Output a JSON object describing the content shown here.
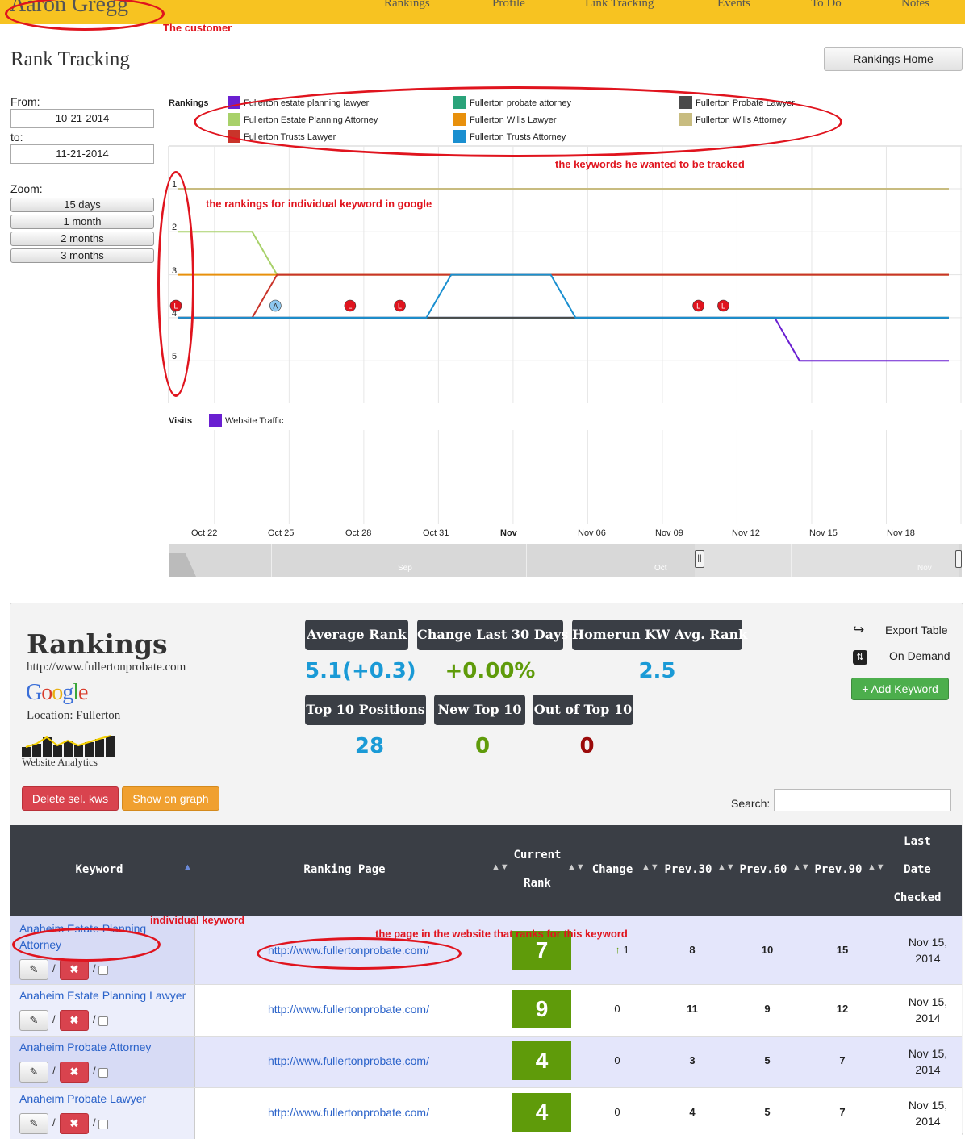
{
  "header": {
    "brand": "Aaron Gregg",
    "nav": [
      "Rankings",
      "Profile",
      "Link Tracking",
      "Events",
      "To Do",
      "Notes"
    ]
  },
  "annotations": {
    "customer": "The customer",
    "keywords": "the keywords he wanted to be tracked",
    "rankings": "the rankings for individual keyword in google",
    "individual": "individual keyword",
    "page": "the page in the website that ranks for this keyword"
  },
  "page": {
    "title": "Rank Tracking",
    "home_button": "Rankings Home"
  },
  "controls": {
    "from_label": "From:",
    "from_value": "10-21-2014",
    "to_label": "to:",
    "to_value": "11-21-2014",
    "zoom_label": "Zoom:",
    "zoom_options": [
      "15 days",
      "1 month",
      "2 months",
      "3 months"
    ]
  },
  "chart_data": {
    "type": "line",
    "title": "",
    "legend_title": "Rankings",
    "legend_placement": "top",
    "grid": true,
    "y_inverted": true,
    "ylim": [
      1,
      5
    ],
    "y_ticks": [
      "1",
      "2",
      "3",
      "4",
      "5"
    ],
    "x_ticks": [
      "Oct 22",
      "Oct 25",
      "Oct 28",
      "Oct 31",
      "Nov",
      "Nov 06",
      "Nov 09",
      "Nov 12",
      "Nov 15",
      "Nov 18"
    ],
    "x_dates": [
      "10-21",
      "10-22",
      "10-23",
      "10-24",
      "10-25",
      "10-26",
      "10-27",
      "10-28",
      "10-29",
      "10-30",
      "10-31",
      "11-01",
      "11-02",
      "11-03",
      "11-04",
      "11-05",
      "11-06",
      "11-07",
      "11-08",
      "11-09",
      "11-10",
      "11-11",
      "11-12",
      "11-13",
      "11-14",
      "11-15",
      "11-16",
      "11-17",
      "11-18",
      "11-19",
      "11-20",
      "11-21"
    ],
    "series": [
      {
        "name": "Fullerton estate planning lawyer",
        "color": "#6a1fd1",
        "values": [
          4,
          4,
          4,
          4,
          4,
          4,
          4,
          4,
          4,
          4,
          4,
          4,
          4,
          4,
          4,
          4,
          4,
          4,
          4,
          4,
          4,
          4,
          4,
          4,
          4,
          5,
          5,
          5,
          5,
          5,
          5,
          5
        ]
      },
      {
        "name": "Fullerton probate attorney",
        "color": "#2aa37a",
        "values": [
          4,
          4,
          4,
          4,
          4,
          4,
          4,
          4,
          4,
          4,
          4,
          4,
          4,
          4,
          4,
          4,
          4,
          4,
          4,
          4,
          4,
          4,
          4,
          4,
          4,
          4,
          4,
          4,
          4,
          4,
          4,
          4
        ]
      },
      {
        "name": "Fullerton Probate Lawyer",
        "color": "#4a4a4a",
        "values": [
          4,
          4,
          4,
          4,
          4,
          4,
          4,
          4,
          4,
          4,
          4,
          4,
          4,
          4,
          4,
          4,
          4,
          4,
          4,
          4,
          4,
          4,
          4,
          4,
          4,
          4,
          4,
          4,
          4,
          4,
          4,
          4
        ]
      },
      {
        "name": "Fullerton Estate Planning Attorney",
        "color": "#a8d16a",
        "values": [
          2,
          2,
          2,
          2,
          3,
          3,
          3,
          3,
          3,
          3,
          3,
          3,
          3,
          3,
          3,
          3,
          3,
          3,
          3,
          3,
          3,
          3,
          3,
          3,
          3,
          3,
          3,
          3,
          3,
          3,
          3,
          3
        ]
      },
      {
        "name": "Fullerton Wills Lawyer",
        "color": "#e8900c",
        "values": [
          3,
          3,
          3,
          3,
          3,
          3,
          3,
          3,
          3,
          3,
          3,
          3,
          3,
          3,
          3,
          3,
          3,
          3,
          3,
          3,
          3,
          3,
          3,
          3,
          3,
          3,
          3,
          3,
          3,
          3,
          3,
          3
        ]
      },
      {
        "name": "Fullerton Wills Attorney",
        "color": "#c8bc80",
        "values": [
          1,
          1,
          1,
          1,
          1,
          1,
          1,
          1,
          1,
          1,
          1,
          1,
          1,
          1,
          1,
          1,
          1,
          1,
          1,
          1,
          1,
          1,
          1,
          1,
          1,
          1,
          1,
          1,
          1,
          1,
          1,
          1
        ]
      },
      {
        "name": "Fullerton Trusts Lawyer",
        "color": "#c9342a",
        "values": [
          4,
          4,
          4,
          4,
          3,
          3,
          3,
          3,
          3,
          3,
          3,
          3,
          3,
          3,
          3,
          3,
          3,
          3,
          3,
          3,
          3,
          3,
          3,
          3,
          3,
          3,
          3,
          3,
          3,
          3,
          3,
          3
        ]
      },
      {
        "name": "Fullerton Trusts Attorney",
        "color": "#1a8fd0",
        "values": [
          4,
          4,
          4,
          4,
          4,
          4,
          4,
          4,
          4,
          4,
          4,
          3,
          3,
          3,
          3,
          3,
          4,
          4,
          4,
          4,
          4,
          4,
          4,
          4,
          4,
          4,
          4,
          4,
          4,
          4,
          4,
          4
        ]
      }
    ],
    "flags": [
      {
        "label": "L",
        "date": "10-21",
        "color": "#e0141e"
      },
      {
        "label": "A",
        "date": "10-25",
        "color": "#8ec8f0"
      },
      {
        "label": "L",
        "date": "10-28",
        "color": "#e0141e"
      },
      {
        "label": "L",
        "date": "10-30",
        "color": "#e0141e"
      },
      {
        "label": "L",
        "date": "11-11",
        "color": "#e0141e"
      },
      {
        "label": "L",
        "date": "11-12",
        "color": "#e0141e"
      }
    ],
    "visits": {
      "legend_title": "Visits",
      "series_name": "Website Traffic",
      "color": "#6a1fd1"
    },
    "navigator_labels": [
      "Sep",
      "Oct",
      "Nov"
    ]
  },
  "rankings_panel": {
    "title": "Rankings",
    "url": "http://www.fullertonprobate.com",
    "engine": "Google",
    "location": "Location: Fullerton",
    "analytics_label": "Website Analytics",
    "stats": [
      {
        "label": "Average Rank",
        "value": "5.1(+0.3)",
        "color": "#1a9ad6"
      },
      {
        "label": "Change Last 30 Days",
        "value": "+0.00%",
        "color": "#5f9b0a"
      },
      {
        "label": "Homerun KW Avg. Rank",
        "value": "2.5",
        "color": "#1a9ad6"
      },
      {
        "label": "Top 10 Positions",
        "value": "28",
        "color": "#1a9ad6"
      },
      {
        "label": "New Top 10",
        "value": "0",
        "color": "#5f9b0a"
      },
      {
        "label": "Out of Top 10",
        "value": "0",
        "color": "#9b0a0a"
      }
    ],
    "export_label": "Export Table",
    "on_demand_label": "On Demand",
    "add_keyword": "+ Add Keyword",
    "delete_selected": "Delete sel. kws",
    "show_graph": "Show on graph",
    "search_label": "Search:"
  },
  "table": {
    "headers": {
      "keyword": "Keyword",
      "page": "Ranking Page",
      "current_rank": [
        "Current",
        "Rank"
      ],
      "change": "Change",
      "prev30": "Prev.30",
      "prev60": "Prev.60",
      "prev90": "Prev.90",
      "last_date": [
        "Last",
        "Date",
        "Checked"
      ]
    },
    "rows": [
      {
        "keyword": "Anaheim Estate Planning Attorney",
        "page": "http://www.fullertonprobate.com/",
        "rank": "7",
        "change": "1",
        "change_up": true,
        "prev30": "8",
        "prev60": "10",
        "prev90": "15",
        "date": "Nov 15, 2014"
      },
      {
        "keyword": "Anaheim Estate Planning Lawyer",
        "page": "http://www.fullertonprobate.com/",
        "rank": "9",
        "change": "0",
        "change_up": false,
        "prev30": "11",
        "prev60": "9",
        "prev90": "12",
        "date": "Nov 15, 2014"
      },
      {
        "keyword": "Anaheim Probate Attorney",
        "page": "http://www.fullertonprobate.com/",
        "rank": "4",
        "change": "0",
        "change_up": false,
        "prev30": "3",
        "prev60": "5",
        "prev90": "7",
        "date": "Nov 15, 2014"
      },
      {
        "keyword": "Anaheim Probate Lawyer",
        "page": "http://www.fullertonprobate.com/",
        "rank": "4",
        "change": "0",
        "change_up": false,
        "prev30": "4",
        "prev60": "5",
        "prev90": "7",
        "date": "Nov 15, 2014"
      }
    ]
  }
}
